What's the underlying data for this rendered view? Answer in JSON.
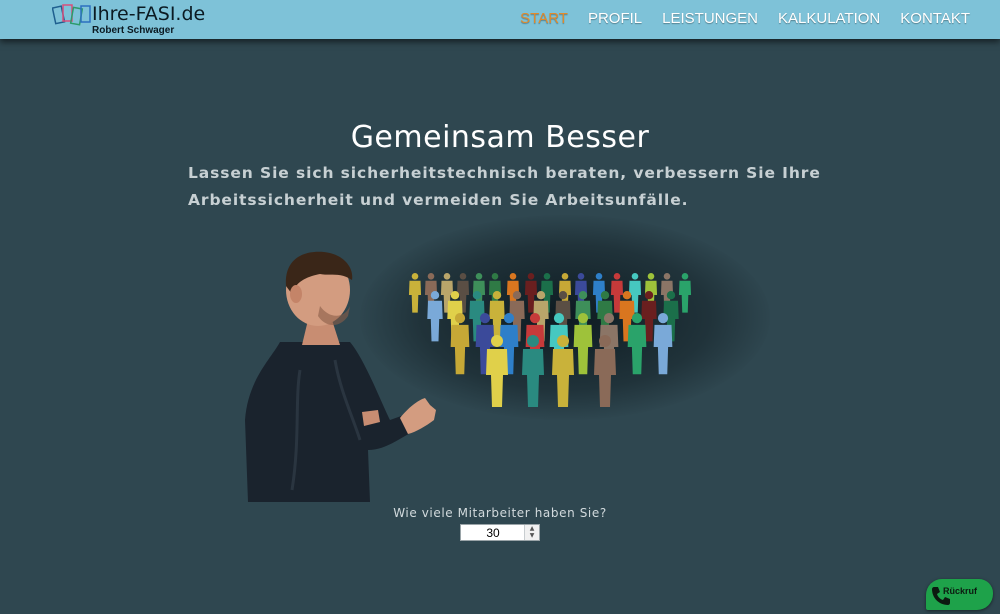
{
  "header": {
    "logo_title": "Ihre-FASI.de",
    "logo_subtitle": "Robert Schwager",
    "nav": [
      {
        "label": "START",
        "active": true
      },
      {
        "label": "PROFIL"
      },
      {
        "label": "LEISTUNGEN"
      },
      {
        "label": "KALKULATION"
      },
      {
        "label": "KONTAKT"
      }
    ]
  },
  "hero": {
    "title": "Gemeinsam Besser",
    "text": "Lassen Sie sich sicherheitstechnisch beraten, verbessern Sie Ihre Arbeitssicherheit und vermeiden Sie Arbeitsunfälle."
  },
  "calculator": {
    "question": "Wie viele Mitarbeiter haben Sie?",
    "employee_count": "30"
  },
  "callback": {
    "label": "Rückruf"
  },
  "colors": {
    "header_bg": "#7ec2d8",
    "page_bg": "#2f4750",
    "nav_active": "#e08a2c",
    "callback_bg": "#1ea24a"
  },
  "icons": [
    "logo-icon",
    "phone-icon",
    "presenter-image",
    "people-group-image"
  ]
}
